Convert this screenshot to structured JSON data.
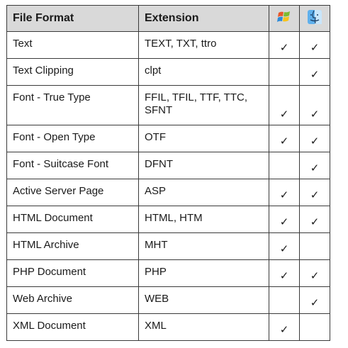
{
  "headers": {
    "file_format": "File Format",
    "extension": "Extension",
    "windows_icon": "windows-logo",
    "mac_icon": "mac-finder-logo"
  },
  "check_glyph": "✓",
  "rows": [
    {
      "format": "Text",
      "extension": "TEXT, TXT, ttro",
      "windows": true,
      "mac": true
    },
    {
      "format": "Text Clipping",
      "extension": "clpt",
      "windows": false,
      "mac": true
    },
    {
      "format": "Font - True Type",
      "extension": "FFIL, TFIL, TTF, TTC, SFNT",
      "windows": true,
      "mac": true
    },
    {
      "format": "Font - Open Type",
      "extension": "OTF",
      "windows": true,
      "mac": true
    },
    {
      "format": "Font - Suitcase Font",
      "extension": "DFNT",
      "windows": false,
      "mac": true
    },
    {
      "format": "Active Server Page",
      "extension": "ASP",
      "windows": true,
      "mac": true
    },
    {
      "format": "HTML Document",
      "extension": "HTML, HTM",
      "windows": true,
      "mac": true
    },
    {
      "format": "HTML Archive",
      "extension": "MHT",
      "windows": true,
      "mac": false
    },
    {
      "format": "PHP Document",
      "extension": "PHP",
      "windows": true,
      "mac": true
    },
    {
      "format": "Web Archive",
      "extension": "WEB",
      "windows": false,
      "mac": true
    },
    {
      "format": "XML Document",
      "extension": "XML",
      "windows": true,
      "mac": false
    }
  ]
}
